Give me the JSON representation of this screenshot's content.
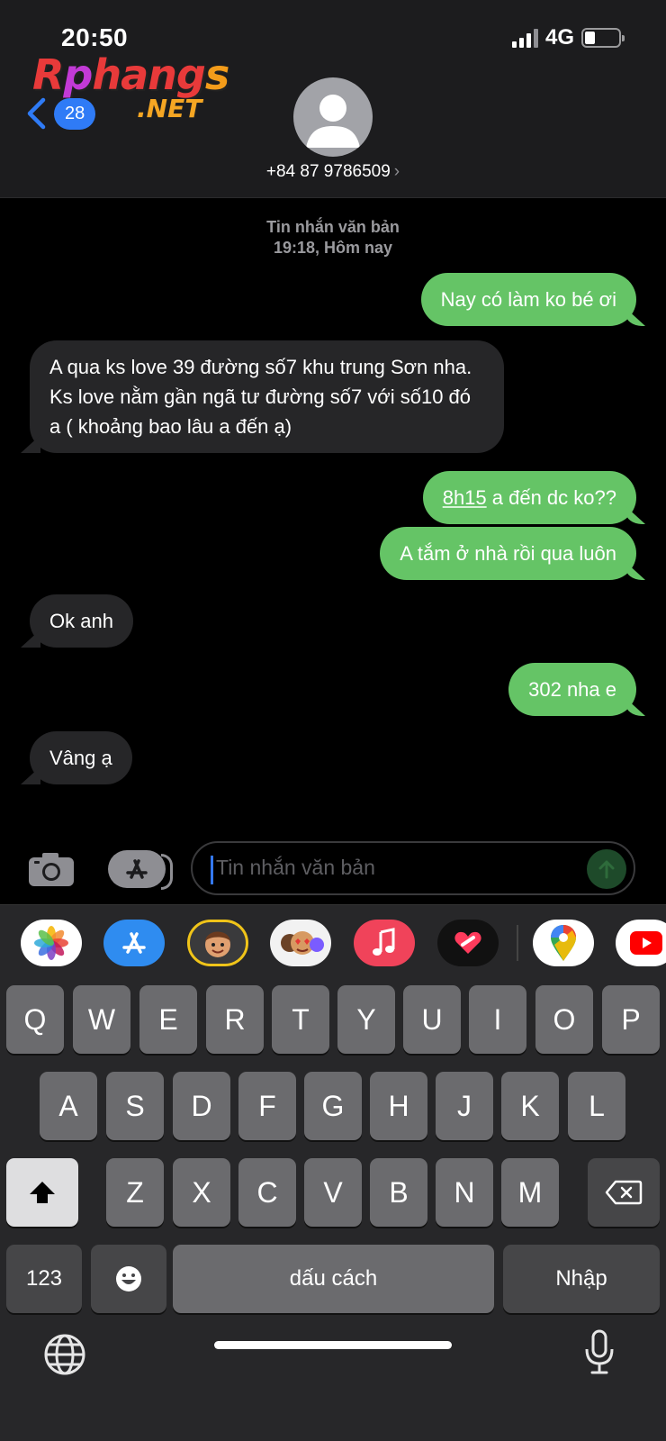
{
  "status_bar": {
    "time": "20:50",
    "network": "4G",
    "battery_level": 0.3
  },
  "header": {
    "logo_text": "Rphangs",
    "logo_sub": ".NET",
    "back_badge": "28",
    "contact_number": "+84 87 9786509",
    "contact_chevron": "›"
  },
  "thread": {
    "meta_line1": "Tin nhắn văn bản",
    "meta_line2": "19:18, Hôm nay",
    "messages": [
      {
        "dir": "out",
        "text": "Nay có làm ko bé ơi"
      },
      {
        "dir": "in",
        "text": "A qua ks love 39 đường số7 khu trung Sơn nha. Ks love nằm gần ngã tư đường số7 với số10 đó a ( khoảng bao lâu a đến ạ)"
      },
      {
        "dir": "out",
        "text_link": "8h15",
        "text_rest": " a đến dc ko??"
      },
      {
        "dir": "out",
        "text": "A tắm ở nhà rồi qua luôn"
      },
      {
        "dir": "in",
        "text": "Ok anh"
      },
      {
        "dir": "out",
        "text": "302 nha e"
      },
      {
        "dir": "in",
        "text": "Vâng ạ"
      }
    ]
  },
  "composer": {
    "placeholder": "Tin nhắn văn bản"
  },
  "app_strip": [
    "photos-icon",
    "app-store-icon",
    "memoji-icon",
    "animoji-stickers-icon",
    "music-icon",
    "digital-touch-icon",
    "google-maps-icon",
    "youtube-icon"
  ],
  "keyboard": {
    "row1": [
      "Q",
      "W",
      "E",
      "R",
      "T",
      "Y",
      "U",
      "I",
      "O",
      "P"
    ],
    "row2": [
      "A",
      "S",
      "D",
      "F",
      "G",
      "H",
      "J",
      "K",
      "L"
    ],
    "row3": [
      "Z",
      "X",
      "C",
      "V",
      "B",
      "N",
      "M"
    ],
    "numbers_key": "123",
    "space_key": "dấu cách",
    "return_key": "Nhập"
  }
}
